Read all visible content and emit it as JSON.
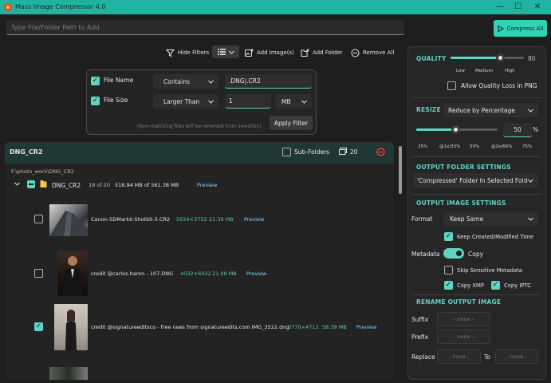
{
  "window": {
    "title": "Mass Image Compressor 4.0",
    "minimize": "—",
    "maximize": "☐",
    "close": "✕"
  },
  "path_input": {
    "placeholder": "Type File/Folder Path to Add"
  },
  "compress_button": {
    "label": "Compress All"
  },
  "toolbar": {
    "hide_filters": "Hide Filters",
    "add_images": "Add Image(s)",
    "add_folder": "Add Folder",
    "remove_all": "Remove All"
  },
  "filters": {
    "file_name": {
      "label": "File Name",
      "checked": true,
      "operator": "Contains",
      "value": ".DNG|.CR2"
    },
    "file_size": {
      "label": "File Size",
      "checked": true,
      "operator": "Larger Than",
      "value": "1",
      "unit": "MB"
    },
    "note": "(Non-matching files will be removed from selection)",
    "apply_label": "Apply Filter"
  },
  "group": {
    "name": "DNG_CR2",
    "subfolders_label": "Sub-Folders",
    "image_count": "20",
    "path": "F:\\photo_work\\DNG_CR2",
    "folder": {
      "name": "DNG_CR2",
      "count": "18 of 20",
      "size": "518.94 MB of 561.38 MB",
      "preview": "Preview"
    },
    "files": [
      {
        "name": "Canon-5DMarkII-Shotkit-3.CR2",
        "dims": "5634×3752",
        "size": "21.36 MB",
        "preview": "Preview",
        "checked": false
      },
      {
        "name": "credit @carlos.haron - 107.DNG",
        "dims": "4032×6032",
        "size": "21.08 MB",
        "preview": "Preview",
        "checked": false
      },
      {
        "name": "credit @signatureeditsco - free raws from signatureedits.com IMG_3522.dng",
        "dims": "3770×4713",
        "size": "58.39 MB",
        "preview": "Preview",
        "checked": true
      }
    ]
  },
  "settings": {
    "quality": {
      "title": "QUALITY",
      "value": "80",
      "level": 80,
      "low": "Low",
      "medium": "Medium",
      "high": "High",
      "allow_png_loss": "Allow Quality Loss in PNG"
    },
    "resize": {
      "title": "RESIZE",
      "mode": "Reduce by Percentage",
      "value": "50",
      "unit": "%",
      "ticks": [
        "25%",
        "@1x/33%",
        "50%",
        "@2x/66%",
        "75%"
      ]
    },
    "output_folder": {
      "title": "OUTPUT FOLDER SETTINGS",
      "value": "'Compressed' Folder In Selected Folde"
    },
    "output_image": {
      "title": "OUTPUT IMAGE SETTINGS",
      "format_label": "Format",
      "format_value": "Keep Same",
      "keep_times": "Keep Created/Modified Time",
      "metadata_label": "Metadata",
      "metadata_value": "Copy",
      "skip_sensitive": "Skip Sensitive Metadata",
      "copy_xmp": "Copy XMP",
      "copy_iptc": "Copy IPTC"
    },
    "rename": {
      "title": "RENAME OUTPUT IMAGE",
      "suffix_label": "Suffix",
      "suffix_placeholder": "- none -",
      "prefix_label": "Prefix",
      "prefix_placeholder": "- none -",
      "replace_label": "Replace",
      "replace_placeholder": "- none -",
      "to_label": "To",
      "to_placeholder": "- none -"
    }
  },
  "colors": {
    "accent": "#5fd4c2",
    "titlebar": "#1fb3a0",
    "background": "#1e1e1e"
  }
}
